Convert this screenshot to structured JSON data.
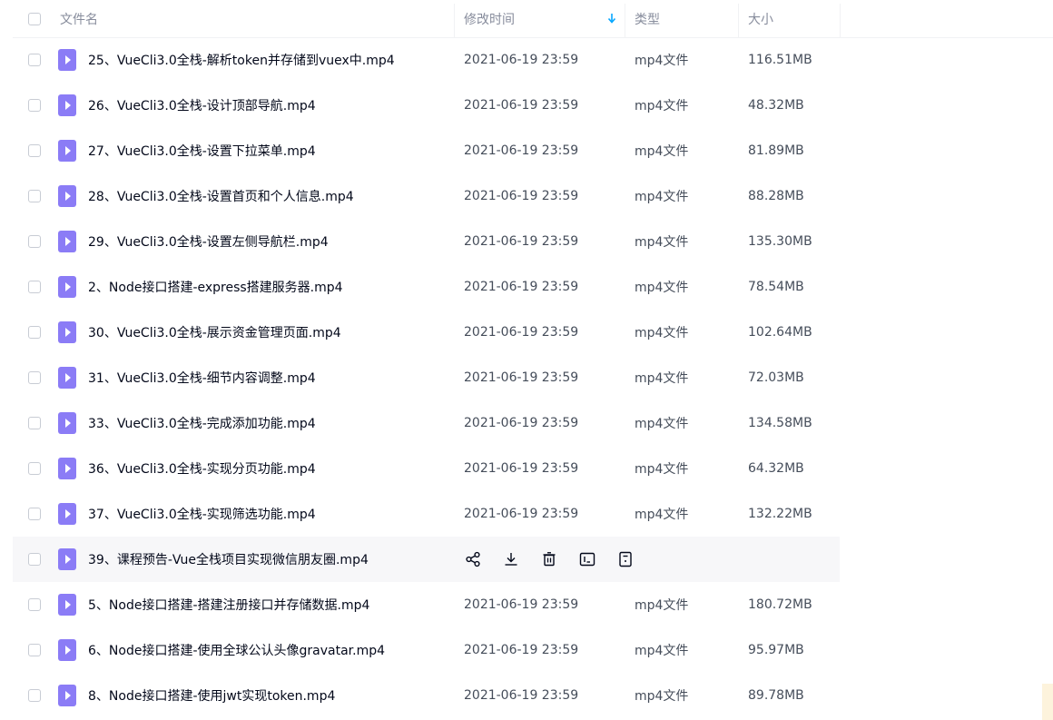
{
  "header": {
    "name": "文件名",
    "modified": "修改时间",
    "type": "类型",
    "size": "大小"
  },
  "icons": {
    "file": "video-file-icon",
    "sort": "sort-down-arrow-icon",
    "actions": [
      "share-icon",
      "download-icon",
      "delete-icon",
      "rename-icon",
      "more-icon"
    ]
  },
  "colors": {
    "accent": "#06a7ff",
    "video_icon": "#8b7cf6",
    "hover_row": "#f7f7f9"
  },
  "files": [
    {
      "name": "25、VueCli3.0全栈-解析token并存储到vuex中.mp4",
      "time": "2021-06-19 23:59",
      "type": "mp4文件",
      "size": "116.51MB"
    },
    {
      "name": "26、VueCli3.0全栈-设计顶部导航.mp4",
      "time": "2021-06-19 23:59",
      "type": "mp4文件",
      "size": "48.32MB"
    },
    {
      "name": "27、VueCli3.0全栈-设置下拉菜单.mp4",
      "time": "2021-06-19 23:59",
      "type": "mp4文件",
      "size": "81.89MB"
    },
    {
      "name": "28、VueCli3.0全栈-设置首页和个人信息.mp4",
      "time": "2021-06-19 23:59",
      "type": "mp4文件",
      "size": "88.28MB"
    },
    {
      "name": "29、VueCli3.0全栈-设置左侧导航栏.mp4",
      "time": "2021-06-19 23:59",
      "type": "mp4文件",
      "size": "135.30MB"
    },
    {
      "name": "2、Node接口搭建-express搭建服务器.mp4",
      "time": "2021-06-19 23:59",
      "type": "mp4文件",
      "size": "78.54MB"
    },
    {
      "name": "30、VueCli3.0全栈-展示资金管理页面.mp4",
      "time": "2021-06-19 23:59",
      "type": "mp4文件",
      "size": "102.64MB"
    },
    {
      "name": "31、VueCli3.0全栈-细节内容调整.mp4",
      "time": "2021-06-19 23:59",
      "type": "mp4文件",
      "size": "72.03MB"
    },
    {
      "name": "33、VueCli3.0全栈-完成添加功能.mp4",
      "time": "2021-06-19 23:59",
      "type": "mp4文件",
      "size": "134.58MB"
    },
    {
      "name": "36、VueCli3.0全栈-实现分页功能.mp4",
      "time": "2021-06-19 23:59",
      "type": "mp4文件",
      "size": "64.32MB"
    },
    {
      "name": "37、VueCli3.0全栈-实现筛选功能.mp4",
      "time": "2021-06-19 23:59",
      "type": "mp4文件",
      "size": "132.22MB"
    },
    {
      "name": "39、课程预告-Vue全栈项目实现微信朋友圈.mp4",
      "time": "",
      "type": "",
      "size": "",
      "hover": true
    },
    {
      "name": "5、Node接口搭建-搭建注册接口并存储数据.mp4",
      "time": "2021-06-19 23:59",
      "type": "mp4文件",
      "size": "180.72MB"
    },
    {
      "name": "6、Node接口搭建-使用全球公认头像gravatar.mp4",
      "time": "2021-06-19 23:59",
      "type": "mp4文件",
      "size": "95.97MB"
    },
    {
      "name": "8、Node接口搭建-使用jwt实现token.mp4",
      "time": "2021-06-19 23:59",
      "type": "mp4文件",
      "size": "89.78MB"
    }
  ]
}
